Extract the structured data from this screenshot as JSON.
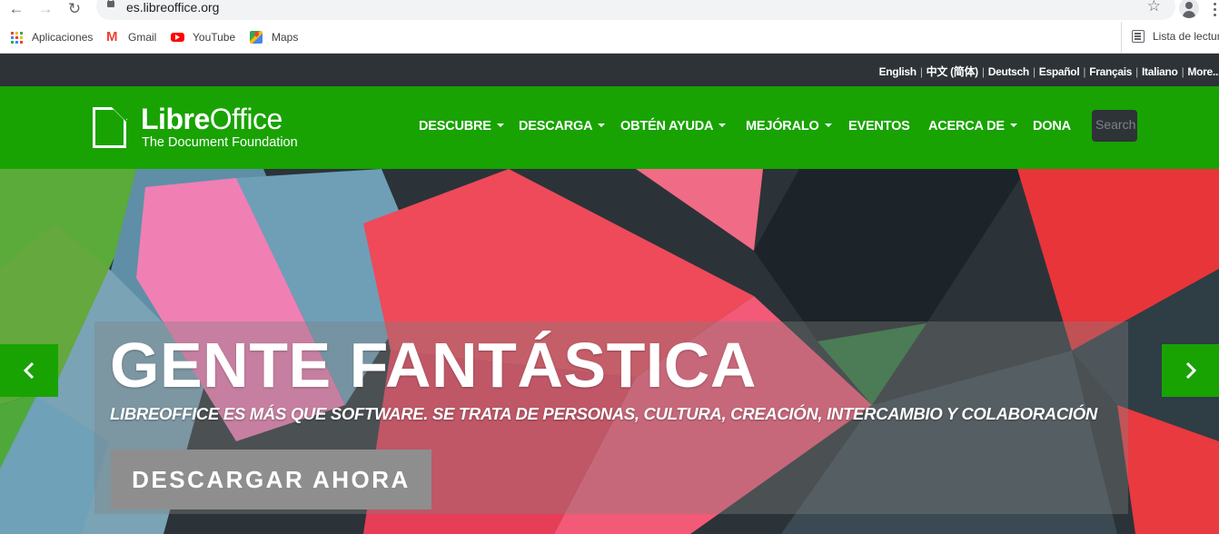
{
  "browser": {
    "url": "es.libreoffice.org",
    "bookmarks": [
      {
        "label": "Aplicaciones",
        "icon": "apps-grid-icon"
      },
      {
        "label": "Gmail",
        "icon": "gmail-icon"
      },
      {
        "label": "YouTube",
        "icon": "youtube-icon"
      },
      {
        "label": "Maps",
        "icon": "maps-icon"
      }
    ],
    "reading_list": "Lista de lectura"
  },
  "languages": [
    "English",
    "中文 (简体)",
    "Deutsch",
    "Español",
    "Français",
    "Italiano",
    "More..."
  ],
  "header": {
    "logo_bold": "Libre",
    "logo_regular": "Office",
    "logo_sub": "The Document Foundation",
    "menu": [
      {
        "label": "DESCUBRE",
        "dropdown": true
      },
      {
        "label": "DESCARGA",
        "dropdown": true
      },
      {
        "label": "OBTÉN AYUDA",
        "dropdown": true
      },
      {
        "label": "MEJÓRALO",
        "dropdown": true
      },
      {
        "label": "EVENTOS",
        "dropdown": false
      },
      {
        "label": "ACERCA DE",
        "dropdown": true
      },
      {
        "label": "DONA",
        "dropdown": false
      }
    ],
    "search_placeholder": "Search"
  },
  "hero": {
    "title": "GENTE FANTÁSTICA",
    "subtitle": "LIBREOFFICE ES MÁS QUE SOFTWARE. SE TRATA DE PERSONAS, CULTURA, CREACIÓN, INTERCAMBIO Y COLABORACIÓN",
    "cta": "DESCARGAR AHORA"
  },
  "colors": {
    "brand_green": "#18a303",
    "dark_bar": "#2d3337"
  }
}
